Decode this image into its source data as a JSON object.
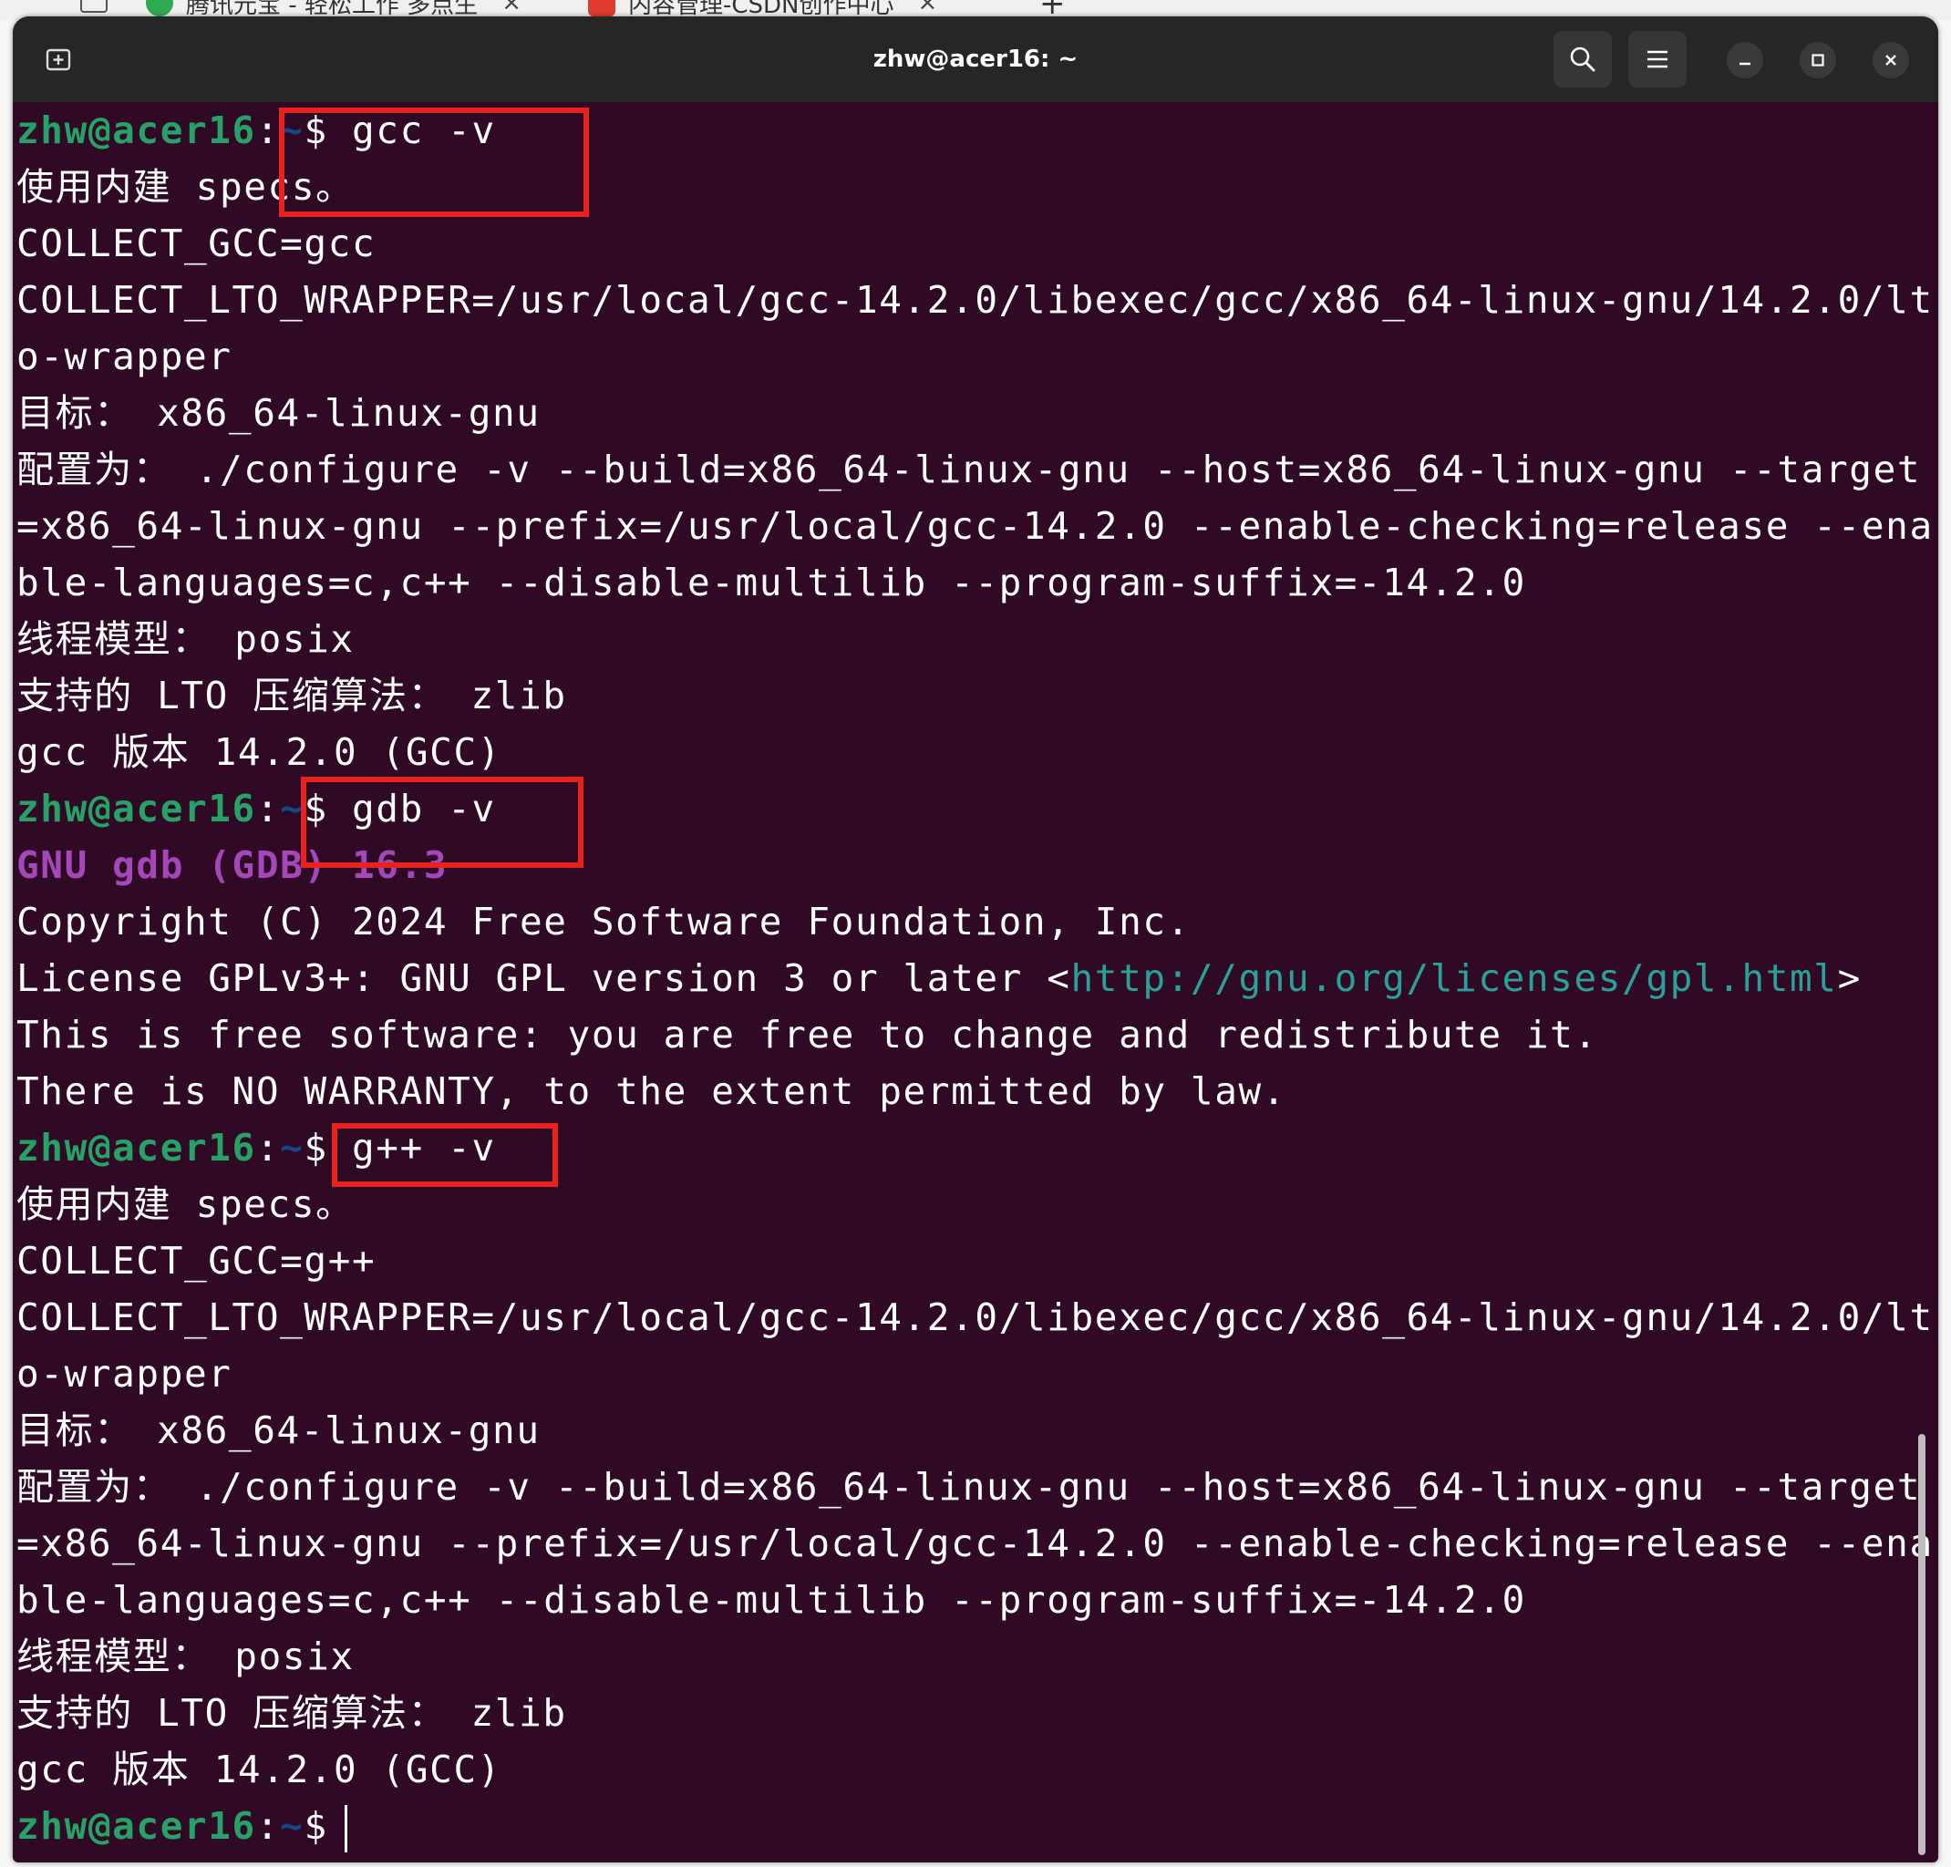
{
  "browser_tabs": [
    {
      "label": "腾讯元宝 - 轻松工作 多点生"
    },
    {
      "label": "内容管理-CSDN创作中心"
    }
  ],
  "tab_close_glyph": "×",
  "tab_add_glyph": "+",
  "window": {
    "title": "zhw@acer16: ~"
  },
  "icons": {
    "new_tab": "new-tab-icon",
    "search": "search-icon",
    "menu": "hamburger-menu-icon",
    "minimize": "minimize-icon",
    "maximize": "maximize-icon",
    "close": "close-icon"
  },
  "colors": {
    "terminal_bg": "#300a24",
    "titlebar_bg": "#262626",
    "prompt_user": "#26a269",
    "prompt_path": "#12488b",
    "gdb_banner": "#a347ba",
    "link": "#2aa198",
    "highlight_box": "#e8231f"
  },
  "prompt": {
    "user_host": "zhw@acer16",
    "sep": ":",
    "path": "~",
    "symbol": "$"
  },
  "commands": {
    "gcc": " gcc -v",
    "gdb": " gdb -v",
    "gpp": " g++ -v"
  },
  "gcc_output": [
    "使用内建 specs。",
    "COLLECT_GCC=gcc",
    "COLLECT_LTO_WRAPPER=/usr/local/gcc-14.2.0/libexec/gcc/x86_64-linux-gnu/14.2.0/lt",
    "o-wrapper",
    "目标： x86_64-linux-gnu",
    "配置为： ./configure -v --build=x86_64-linux-gnu --host=x86_64-linux-gnu --target",
    "=x86_64-linux-gnu --prefix=/usr/local/gcc-14.2.0 --enable-checking=release --ena",
    "ble-languages=c,c++ --disable-multilib --program-suffix=-14.2.0",
    "线程模型： posix",
    "支持的 LTO 压缩算法： zlib",
    "gcc 版本 14.2.0 (GCC)"
  ],
  "gdb_output": {
    "banner": "GNU gdb (GDB) 16.3",
    "copyright": "Copyright (C) 2024 Free Software Foundation, Inc.",
    "license_prefix": "License GPLv3+: GNU GPL version 3 or later <",
    "license_url": "http://gnu.org/licenses/gpl.html",
    "license_suffix": ">",
    "free": "This is free software: you are free to change and redistribute it.",
    "warranty": "There is NO WARRANTY, to the extent permitted by law."
  },
  "gpp_output": [
    "使用内建 specs。",
    "COLLECT_GCC=g++",
    "COLLECT_LTO_WRAPPER=/usr/local/gcc-14.2.0/libexec/gcc/x86_64-linux-gnu/14.2.0/lt",
    "o-wrapper",
    "目标： x86_64-linux-gnu",
    "配置为： ./configure -v --build=x86_64-linux-gnu --host=x86_64-linux-gnu --target",
    "=x86_64-linux-gnu --prefix=/usr/local/gcc-14.2.0 --enable-checking=release --ena",
    "ble-languages=c,c++ --disable-multilib --program-suffix=-14.2.0",
    "线程模型： posix",
    "支持的 LTO 压缩算法： zlib",
    "gcc 版本 14.2.0 (GCC)"
  ]
}
